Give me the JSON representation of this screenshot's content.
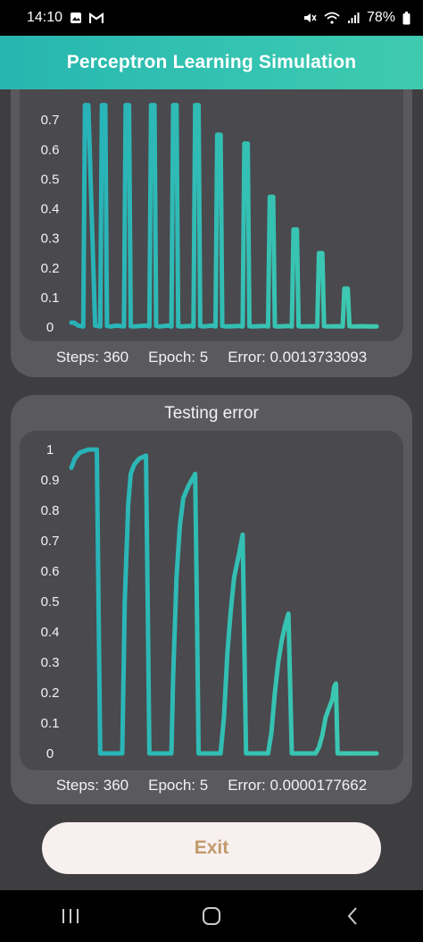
{
  "status_bar": {
    "time": "14:10",
    "battery": "78%",
    "left_icons": [
      "image-icon",
      "gmail-icon"
    ],
    "right_icons": [
      "mute-icon",
      "wifi-icon",
      "signal-icon",
      "battery-icon"
    ]
  },
  "app_bar": {
    "title": "Perceptron Learning Simulation"
  },
  "training": {
    "stats": {
      "steps": "Steps: 360",
      "epoch": "Epoch: 5",
      "error": "Error: 0.0013733093"
    }
  },
  "testing": {
    "title": "Testing error",
    "stats": {
      "steps": "Steps: 360",
      "epoch": "Epoch: 5",
      "error": "Error: 0.0000177662"
    }
  },
  "exit_button": {
    "label": "Exit"
  },
  "colors": {
    "accent": "#2fbdb0",
    "app_bar": "#35c4b1",
    "panel": "#5a595d",
    "chart_bg": "#4a494d",
    "exit_text": "#c19a6b"
  },
  "chart_data": [
    {
      "type": "line",
      "name": "training",
      "xlim": [
        0,
        360
      ],
      "ylim": [
        0,
        0.8
      ],
      "yticks": [
        "0",
        "0.1",
        "0.2",
        "0.3",
        "0.4",
        "0.5",
        "0.6",
        "0.7"
      ],
      "series": [
        {
          "x": [
            0,
            3,
            8,
            14,
            16,
            20,
            28,
            34,
            36,
            40,
            42,
            46,
            54,
            62,
            64,
            68,
            70,
            74,
            88,
            92,
            94,
            98,
            100,
            104,
            114,
            118,
            120,
            124,
            126,
            130,
            140,
            144,
            146,
            150,
            152,
            156,
            166,
            170,
            172,
            176,
            178,
            182,
            198,
            202,
            204,
            208,
            210,
            214,
            228,
            232,
            234,
            238,
            240,
            244,
            256,
            260,
            262,
            266,
            268,
            272,
            286,
            290,
            292,
            296,
            298,
            302,
            316,
            320,
            322,
            326,
            328,
            332,
            345,
            349,
            351,
            355,
            357,
            360
          ],
          "y": [
            0.015,
            0.015,
            0.005,
            0.002,
            0.75,
            0.75,
            0.005,
            0.002,
            0.75,
            0.75,
            0.004,
            0.002,
            0.005,
            0.002,
            0.75,
            0.75,
            0.003,
            0.002,
            0.005,
            0.002,
            0.75,
            0.75,
            0.004,
            0.002,
            0.005,
            0.002,
            0.75,
            0.75,
            0.003,
            0.002,
            0.004,
            0.002,
            0.75,
            0.75,
            0.004,
            0.002,
            0.005,
            0.002,
            0.65,
            0.65,
            0.004,
            0.002,
            0.004,
            0.002,
            0.62,
            0.62,
            0.003,
            0.002,
            0.004,
            0.002,
            0.44,
            0.44,
            0.003,
            0.002,
            0.004,
            0.002,
            0.33,
            0.33,
            0.003,
            0.002,
            0.003,
            0.002,
            0.25,
            0.25,
            0.003,
            0.002,
            0.003,
            0.002,
            0.13,
            0.13,
            0.003,
            0.002,
            0.003,
            0.002,
            0.002,
            0.002,
            0.002,
            0.002
          ]
        }
      ]
    },
    {
      "type": "line",
      "name": "testing",
      "title": "Testing error",
      "xlim": [
        0,
        360
      ],
      "ylim": [
        0,
        1
      ],
      "yticks": [
        "0",
        "0.1",
        "0.2",
        "0.3",
        "0.4",
        "0.5",
        "0.6",
        "0.7",
        "0.8",
        "0.9",
        "1"
      ],
      "series": [
        {
          "x": [
            0,
            4,
            10,
            20,
            30,
            32,
            34,
            60,
            63,
            67,
            70,
            74,
            80,
            88,
            90,
            92,
            118,
            120,
            124,
            128,
            132,
            138,
            146,
            148,
            150,
            176,
            180,
            184,
            188,
            192,
            198,
            202,
            204,
            206,
            232,
            236,
            240,
            244,
            248,
            252,
            256,
            258,
            260,
            288,
            292,
            296,
            300,
            304,
            308,
            310,
            312,
            314,
            342,
            346,
            350,
            354,
            358,
            360
          ],
          "y": [
            0.94,
            0.97,
            0.99,
            1.0,
            1.0,
            0.5,
            0.0,
            0.0,
            0.5,
            0.82,
            0.92,
            0.95,
            0.97,
            0.98,
            0.5,
            0.0,
            0.0,
            0.25,
            0.58,
            0.75,
            0.84,
            0.88,
            0.92,
            0.5,
            0.0,
            0.0,
            0.12,
            0.33,
            0.47,
            0.58,
            0.66,
            0.72,
            0.36,
            0.0,
            0.0,
            0.07,
            0.2,
            0.3,
            0.37,
            0.42,
            0.46,
            0.23,
            0.0,
            0.0,
            0.02,
            0.06,
            0.12,
            0.15,
            0.18,
            0.22,
            0.23,
            0.0,
            0.0,
            0.0,
            0.0,
            0.0,
            0.0,
            0.0
          ]
        }
      ]
    }
  ]
}
